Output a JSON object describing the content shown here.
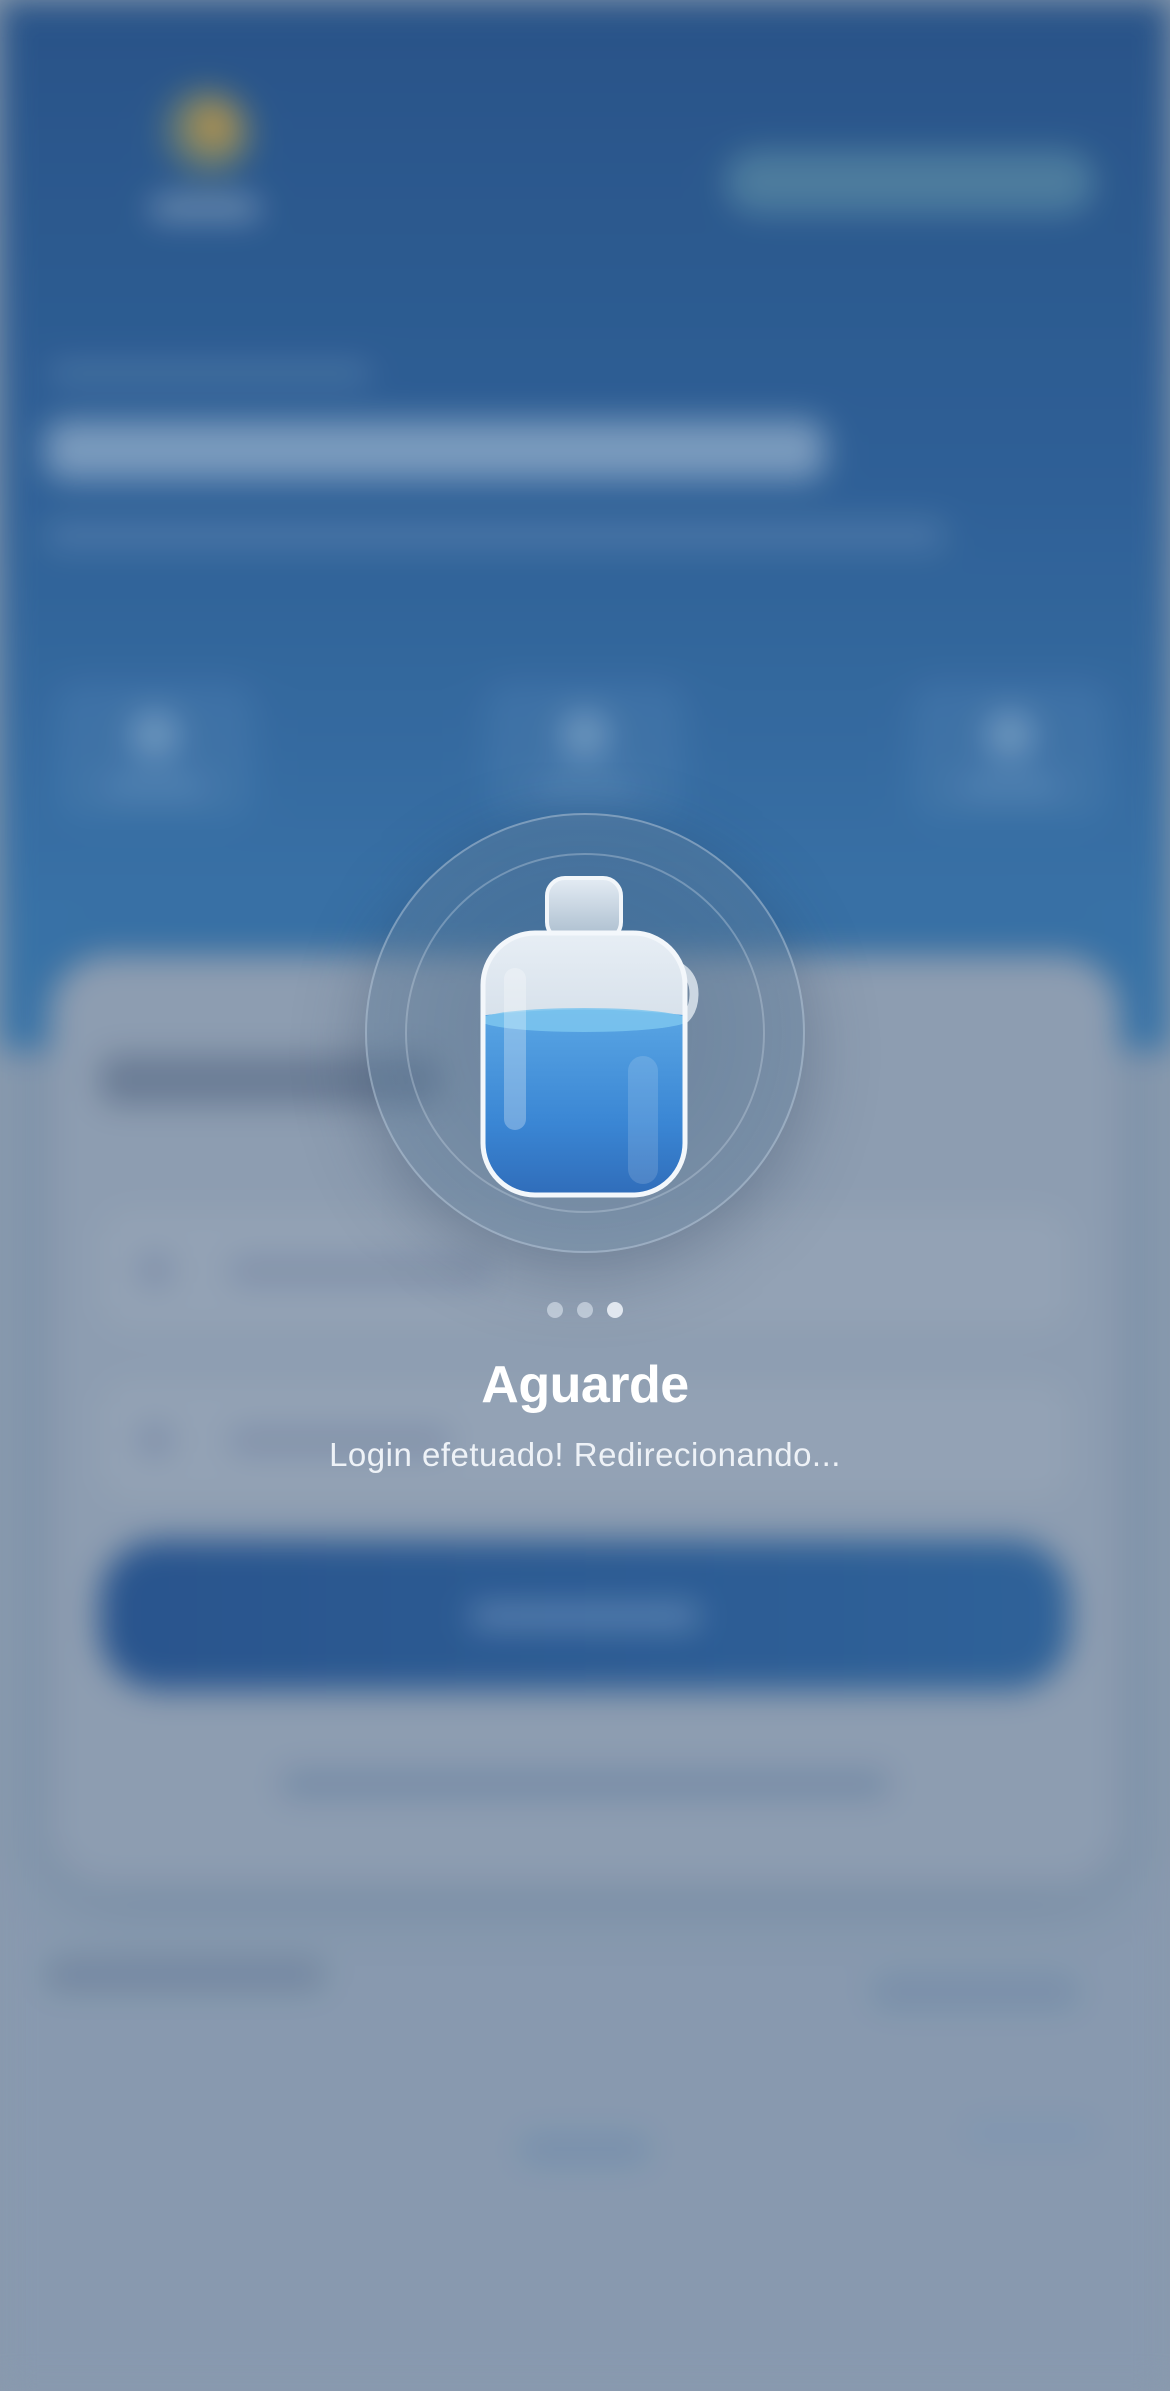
{
  "loader": {
    "title": "Aguarde",
    "message": "Login efetuado! Redirecionando...",
    "icon": "water-jug-icon",
    "progress_dots": {
      "count": 3,
      "active_index": 2
    }
  },
  "colors": {
    "water": "#3a86d4",
    "water_light": "#7cc6ee",
    "overlay_tint": "#8c9cae",
    "hero_blue": "#2a5d96"
  }
}
